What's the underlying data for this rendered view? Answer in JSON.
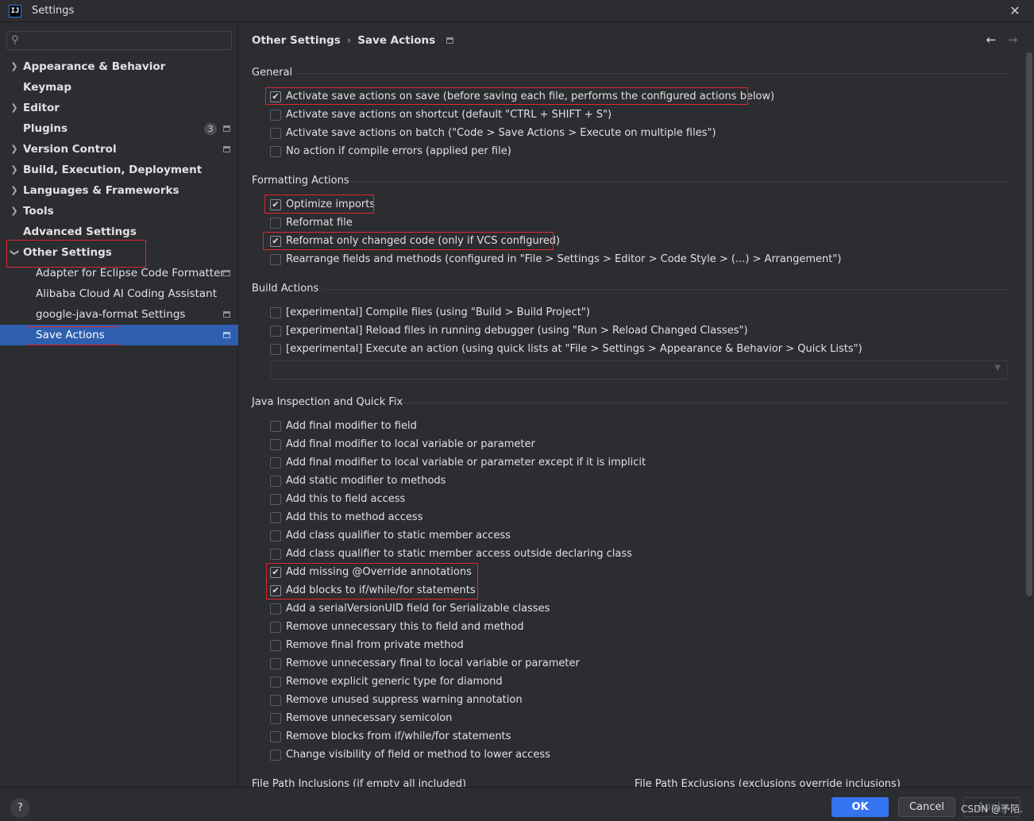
{
  "window": {
    "title": "Settings",
    "app_icon_text": "IJ"
  },
  "search": {
    "placeholder": "",
    "icon": "search-icon"
  },
  "sidebar": {
    "items": [
      {
        "label": "Appearance & Behavior",
        "expandable": true
      },
      {
        "label": "Keymap",
        "expandable": false
      },
      {
        "label": "Editor",
        "expandable": true
      },
      {
        "label": "Plugins",
        "expandable": false,
        "badge": "3"
      },
      {
        "label": "Version Control",
        "expandable": true
      },
      {
        "label": "Build, Execution, Deployment",
        "expandable": true
      },
      {
        "label": "Languages & Frameworks",
        "expandable": true
      },
      {
        "label": "Tools",
        "expandable": true
      },
      {
        "label": "Advanced Settings",
        "expandable": false
      },
      {
        "label": "Other Settings",
        "expandable": true,
        "expanded": true
      },
      {
        "label": "Adapter for Eclipse Code Formatter",
        "child": true
      },
      {
        "label": "Alibaba Cloud AI Coding Assistant",
        "child": true
      },
      {
        "label": "google-java-format Settings",
        "child": true
      },
      {
        "label": "Save Actions",
        "child": true,
        "selected": true
      }
    ]
  },
  "breadcrumb": {
    "parent": "Other Settings",
    "separator": "›",
    "current": "Save Actions"
  },
  "nav": {
    "back": "←",
    "forward": "→"
  },
  "sections": {
    "general": {
      "title": "General",
      "items": [
        {
          "label": "Activate save actions on save (before saving each file, performs the configured actions below)",
          "checked": true
        },
        {
          "label": "Activate save actions on shortcut (default \"CTRL + SHIFT + S\")",
          "checked": false
        },
        {
          "label": "Activate save actions on batch (\"Code > Save Actions > Execute on multiple files\")",
          "checked": false
        },
        {
          "label": "No action if compile errors (applied per file)",
          "checked": false
        }
      ]
    },
    "formatting": {
      "title": "Formatting Actions",
      "items": [
        {
          "label": "Optimize imports",
          "checked": true
        },
        {
          "label": "Reformat file",
          "checked": false
        },
        {
          "label": "Reformat only changed code (only if VCS configured)",
          "checked": true
        },
        {
          "label": "Rearrange fields and methods (configured in \"File > Settings > Editor > Code Style > (...) > Arrangement\")",
          "checked": false
        }
      ]
    },
    "build": {
      "title": "Build Actions",
      "items": [
        {
          "label": "[experimental] Compile files (using \"Build > Build Project\")",
          "checked": false
        },
        {
          "label": "[experimental] Reload files in running debugger (using \"Run > Reload Changed Classes\")",
          "checked": false
        },
        {
          "label": "[experimental] Execute an action (using quick lists at \"File > Settings > Appearance & Behavior > Quick Lists\")",
          "checked": false
        }
      ],
      "combo_value": ""
    },
    "java": {
      "title": "Java Inspection and Quick Fix",
      "items": [
        {
          "label": "Add final modifier to field",
          "checked": false
        },
        {
          "label": "Add final modifier to local variable or parameter",
          "checked": false
        },
        {
          "label": "Add final modifier to local variable or parameter except if it is implicit",
          "checked": false
        },
        {
          "label": "Add static modifier to methods",
          "checked": false
        },
        {
          "label": "Add this to field access",
          "checked": false
        },
        {
          "label": "Add this to method access",
          "checked": false
        },
        {
          "label": "Add class qualifier to static member access",
          "checked": false
        },
        {
          "label": "Add class qualifier to static member access outside declaring class",
          "checked": false
        },
        {
          "label": "Add missing @Override annotations",
          "checked": true
        },
        {
          "label": "Add blocks to if/while/for statements",
          "checked": true
        },
        {
          "label": "Add a serialVersionUID field for Serializable classes",
          "checked": false
        },
        {
          "label": "Remove unnecessary this to field and method",
          "checked": false
        },
        {
          "label": "Remove final from private method",
          "checked": false
        },
        {
          "label": "Remove unnecessary final to local variable or parameter",
          "checked": false
        },
        {
          "label": "Remove explicit generic type for diamond",
          "checked": false
        },
        {
          "label": "Remove unused suppress warning annotation",
          "checked": false
        },
        {
          "label": "Remove unnecessary semicolon",
          "checked": false
        },
        {
          "label": "Remove blocks from if/while/for statements",
          "checked": false
        },
        {
          "label": "Change visibility of field or method to lower access",
          "checked": false
        }
      ]
    },
    "inclusions": {
      "title": "File Path Inclusions (if empty all included)"
    },
    "exclusions": {
      "title": "File Path Exclusions (exclusions override inclusions)"
    }
  },
  "footer": {
    "help": "?",
    "ok": "OK",
    "cancel": "Cancel",
    "apply": "Apply",
    "watermark": "CSDN @予陌."
  },
  "colors": {
    "accent": "#3574f0",
    "selection": "#2e5eae",
    "highlight_box": "#e0262c",
    "background": "#2b2d30"
  }
}
